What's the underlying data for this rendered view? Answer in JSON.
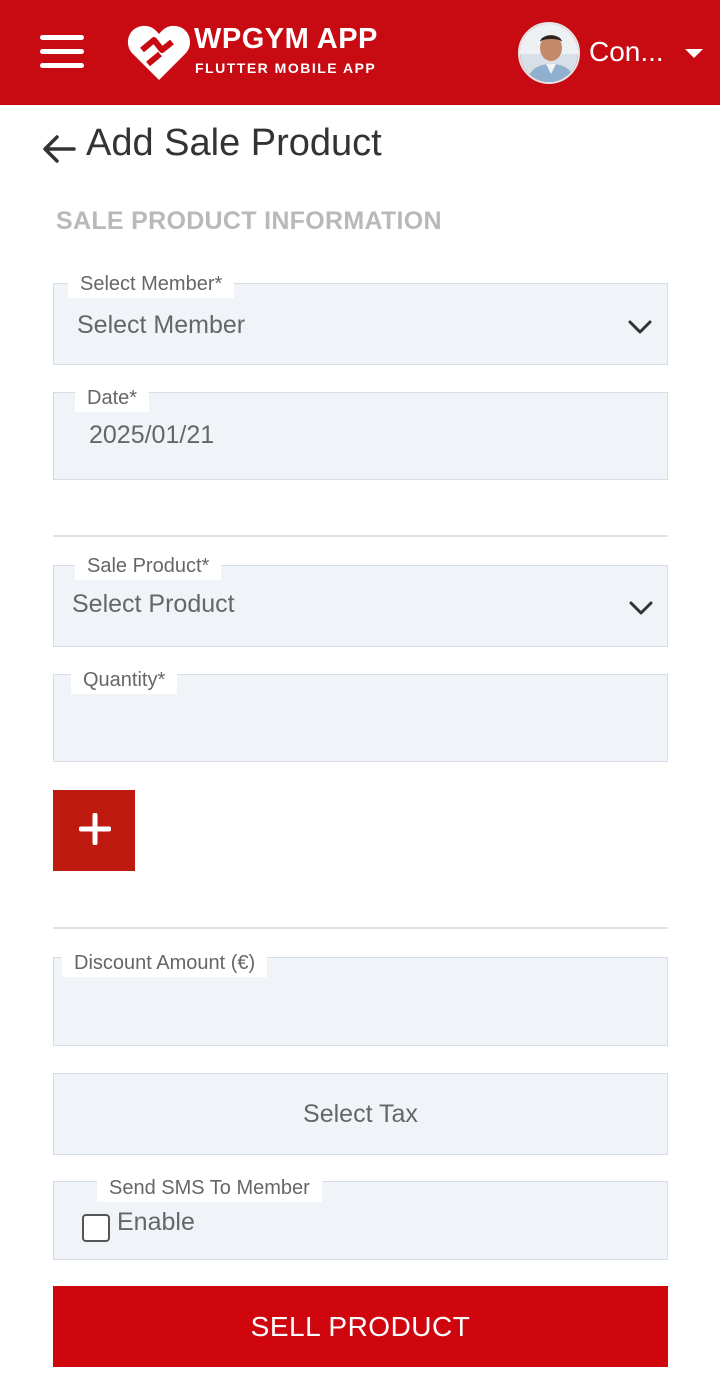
{
  "header": {
    "logo_title": "WPGYM APP",
    "logo_subtitle": "FLUTTER MOBILE APP",
    "user_name": "Con...",
    "brand_color": "#c80a12",
    "icons": [
      "menu-icon",
      "heart-logo-icon",
      "avatar",
      "caret-down-icon"
    ]
  },
  "page": {
    "title": "Add Sale Product",
    "section_title": "SALE PRODUCT INFORMATION"
  },
  "form": {
    "member": {
      "label": "Select Member*",
      "value": "Select Member"
    },
    "date": {
      "label": "Date*",
      "value": "2025/01/21"
    },
    "product": {
      "label": "Sale Product*",
      "value": "Select Product"
    },
    "quantity": {
      "label": "Quantity*",
      "value": ""
    },
    "discount": {
      "label": "Discount Amount (€)",
      "value": ""
    },
    "tax": {
      "value": "Select Tax"
    },
    "sms": {
      "label": "Send SMS To Member",
      "option": "Enable",
      "checked": false
    }
  },
  "actions": {
    "add_icon": "plus-icon",
    "submit": "SELL PRODUCT",
    "submit_color": "#d0060e"
  }
}
